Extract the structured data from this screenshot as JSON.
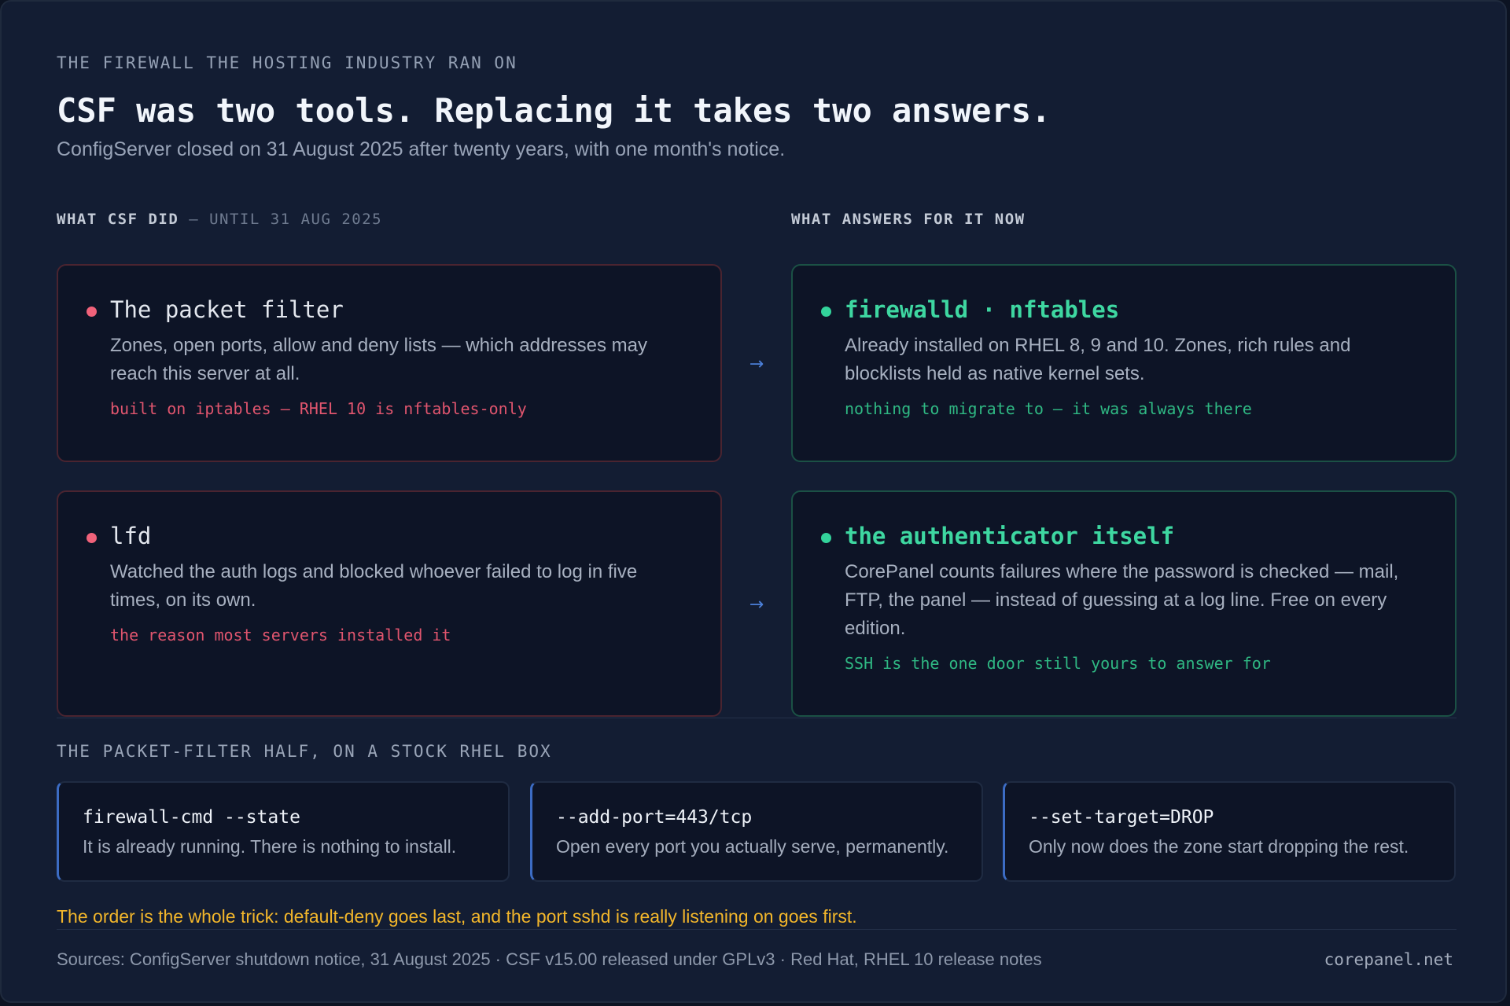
{
  "header": {
    "eyebrow": "THE FIREWALL THE HOSTING INDUSTRY RAN ON",
    "title": "CSF was two tools. Replacing it takes two answers.",
    "subtitle": "ConfigServer closed on 31 August 2025 after twenty years, with one month's notice."
  },
  "columns": {
    "left_label": "WHAT CSF DID",
    "left_sublabel": "— UNTIL 31 AUG 2025",
    "right_label": "WHAT ANSWERS FOR IT NOW"
  },
  "rows": [
    {
      "old": {
        "title": "The packet filter",
        "body": "Zones, open ports, allow and deny lists — which addresses may reach this server at all.",
        "note": "built on iptables — RHEL 10 is nftables-only"
      },
      "arrow": "→",
      "new": {
        "title": "firewalld · nftables",
        "body": "Already installed on RHEL 8, 9 and 10. Zones, rich rules and blocklists held as native kernel sets.",
        "note": "nothing to migrate to — it was always there"
      }
    },
    {
      "old": {
        "title": "lfd",
        "body": "Watched the auth logs and blocked whoever failed to log in five times, on its own.",
        "note": "the reason most servers installed it"
      },
      "arrow": "→",
      "new": {
        "title": "the authenticator itself",
        "body": "CorePanel counts failures where the password is checked — mail, FTP, the panel — instead of guessing at a log line. Free on every edition.",
        "note": "SSH is the one door still yours to answer for"
      }
    }
  ],
  "packet_filter": {
    "heading": "THE PACKET-FILTER HALF, ON A STOCK RHEL BOX",
    "steps": [
      {
        "code": "firewall-cmd --state",
        "desc": "It is already running. There is nothing to install."
      },
      {
        "code": "--add-port=443/tcp",
        "desc": "Open every port you actually serve, permanently."
      },
      {
        "code": "--set-target=DROP",
        "desc": "Only now does the zone start dropping the rest."
      }
    ],
    "warning": "The order is the whole trick: default-deny goes last, and the port sshd is really listening on goes first."
  },
  "footer": {
    "sources": "Sources: ConfigServer shutdown notice, 31 August 2025 · CSF v15.00 released under GPLv3 · Red Hat, RHEL 10 release notes",
    "site": "corepanel.net"
  },
  "colors": {
    "old_accent": "#f0627a",
    "new_accent": "#33d39b",
    "step_accent": "#3c6cc4",
    "warning": "#f2b62b"
  }
}
